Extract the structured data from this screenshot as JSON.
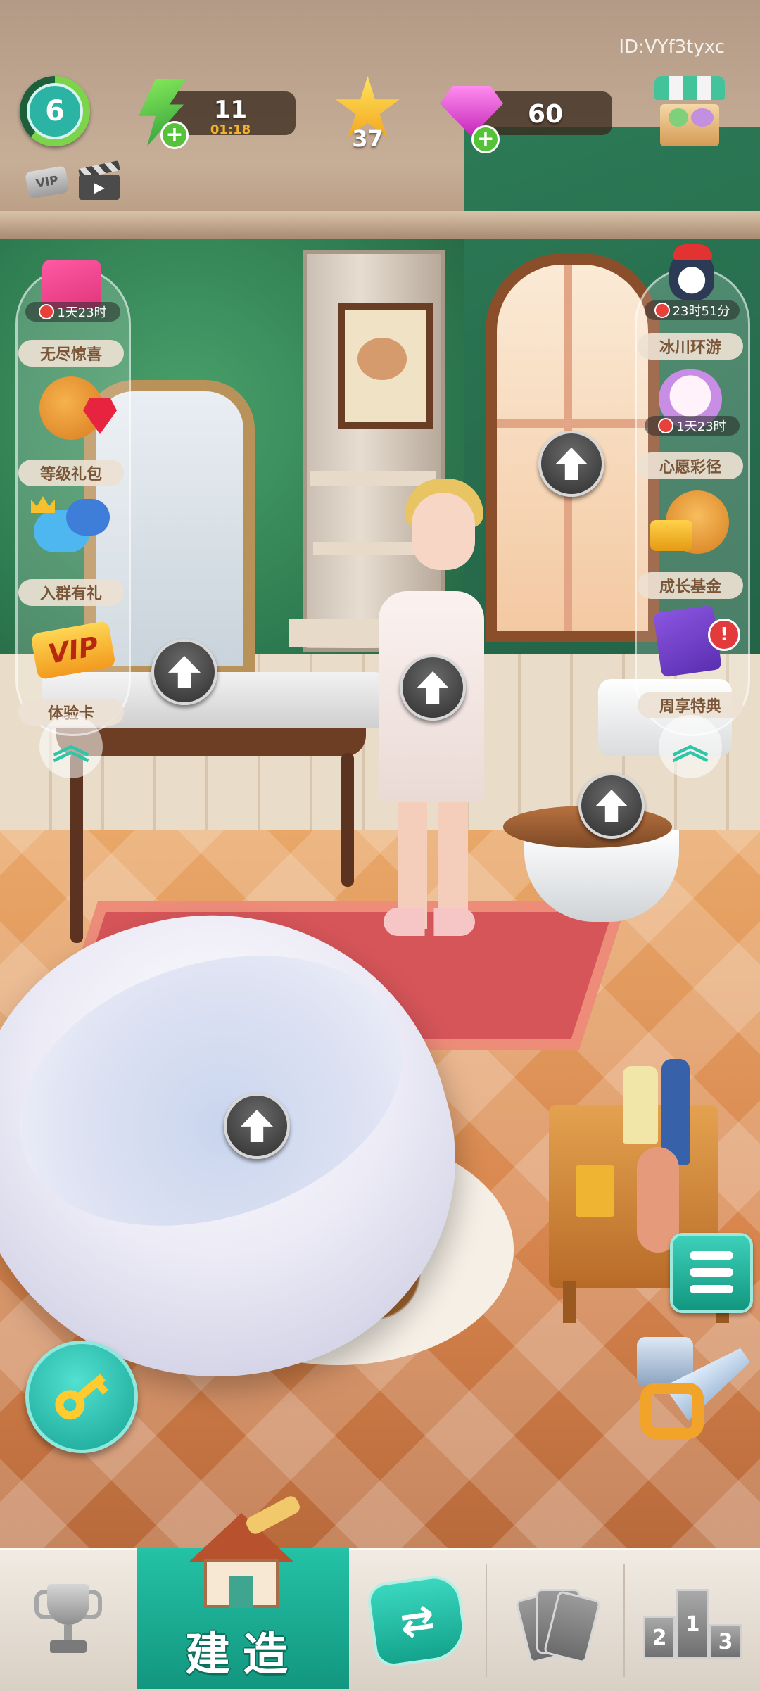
{
  "header": {
    "player_id": "ID:VYf3tyxc",
    "level": "6",
    "energy": {
      "value": "11",
      "timer": "01:18"
    },
    "stars": "37",
    "gems": "60",
    "vip_badge": "VIP"
  },
  "left_rail": [
    {
      "label": "无尽惊喜",
      "timer": "1天23时"
    },
    {
      "label": "等级礼包"
    },
    {
      "label": "入群有礼"
    },
    {
      "label": "体验卡",
      "icon_text": "VIP"
    }
  ],
  "right_rail": [
    {
      "label": "冰川环游",
      "timer": "23时51分"
    },
    {
      "label": "心愿彩径",
      "timer": "1天23时"
    },
    {
      "label": "成长基金"
    },
    {
      "label": "周享特典",
      "badge": "!"
    }
  ],
  "bottom_nav": {
    "build_label": "建造",
    "podium_places": [
      "2",
      "1",
      "3"
    ]
  },
  "colors": {
    "accent_teal": "#1fb69c",
    "upgrade_button": "#3a3a3a",
    "key_button": "#2cc3b2"
  },
  "icons": [
    "level-ring",
    "energy-bolt-icon",
    "star-icon",
    "gem-icon",
    "shop-icon",
    "vip-icon",
    "clapperboard-icon",
    "up-arrow-icon",
    "key-icon",
    "list-icon",
    "tools-icon",
    "trophy-icon",
    "swap-icon",
    "cards-icon",
    "podium-icon",
    "house-icon"
  ]
}
